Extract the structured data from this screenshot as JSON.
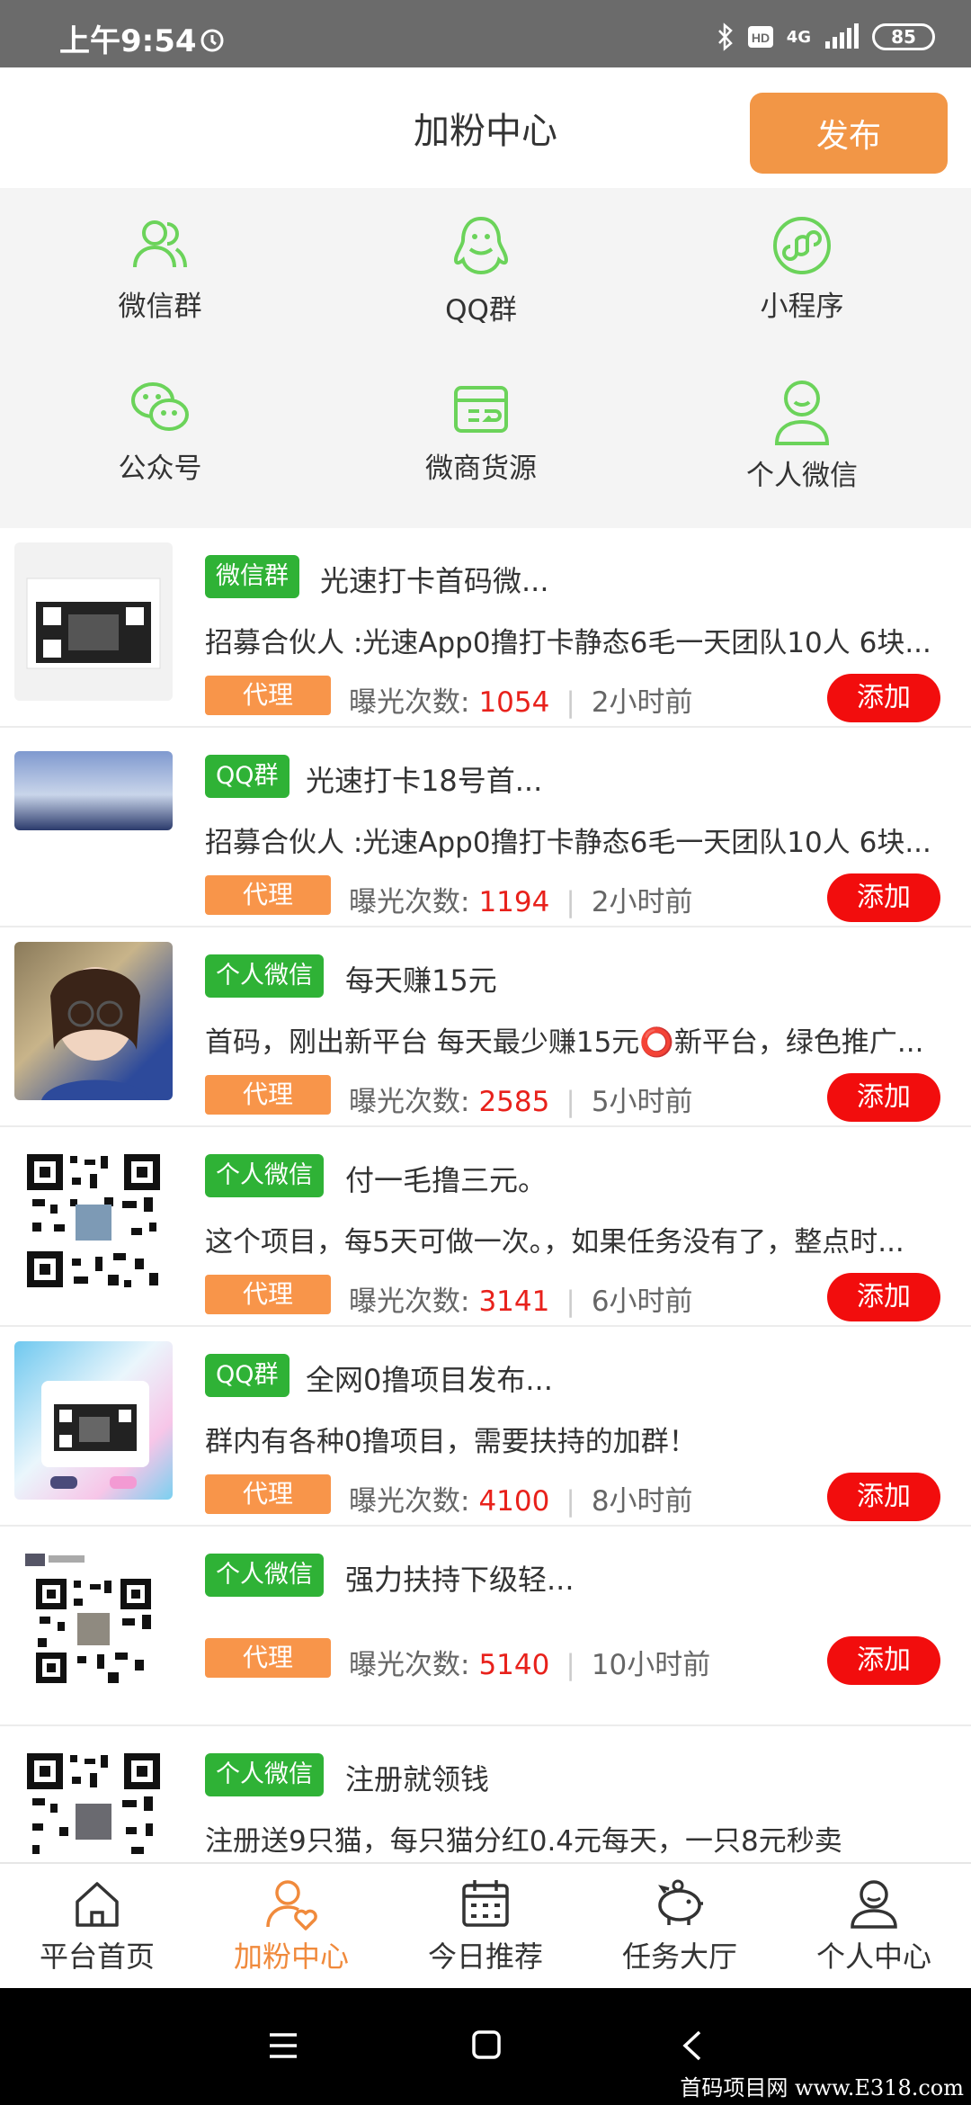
{
  "status_bar": {
    "time": "上午9:54",
    "network": "4G",
    "battery": "85"
  },
  "header": {
    "title": "加粉中心",
    "publish_label": "发布"
  },
  "categories": [
    {
      "label": "微信群",
      "icon": "users-icon"
    },
    {
      "label": "QQ群",
      "icon": "qq-penguin-icon"
    },
    {
      "label": "小程序",
      "icon": "mini-program-icon"
    },
    {
      "label": "公众号",
      "icon": "wechat-icon"
    },
    {
      "label": "微商货源",
      "icon": "supply-box-icon"
    },
    {
      "label": "个人微信",
      "icon": "person-icon"
    }
  ],
  "list_labels": {
    "exposure": "曝光次数:",
    "agent": "代理",
    "add": "添加"
  },
  "items": [
    {
      "tag": "微信群",
      "title": "光速打卡首码微...",
      "desc": "招募合伙人 :光速App0撸打卡静态6毛一天团队10人 6块...",
      "count": "1054",
      "time": "2小时前",
      "thumb": "qr-screenshot"
    },
    {
      "tag": "QQ群",
      "title": "光速打卡18号首...",
      "desc": "招募合伙人 :光速App0撸打卡静态6毛一天团队10人 6块...",
      "count": "1194",
      "time": "2小时前",
      "thumb": "sky-photo"
    },
    {
      "tag": "个人微信",
      "title": "每天赚15元",
      "desc": "首码，刚出新平台 每天最少赚15元⭕新平台，绿色推广...",
      "count": "2585",
      "time": "5小时前",
      "thumb": "portrait-photo"
    },
    {
      "tag": "个人微信",
      "title": "付一毛撸三元。",
      "desc": "这个项目，每5天可做一次。，如果任务没有了，整点时...",
      "count": "3141",
      "time": "6小时前",
      "thumb": "qr-code"
    },
    {
      "tag": "QQ群",
      "title": "全网0撸项目发布...",
      "desc": "群内有各种0撸项目，需要扶持的加群！",
      "count": "4100",
      "time": "8小时前",
      "thumb": "qr-colorful"
    },
    {
      "tag": "个人微信",
      "title": "强力扶持下级轻...",
      "desc": "",
      "count": "5140",
      "time": "10小时前",
      "thumb": "qr-code"
    },
    {
      "tag": "个人微信",
      "title": "注册就领钱",
      "desc": "注册送9只猫，每只猫分红0.4元每天，一只8元秒卖",
      "count": "",
      "time": "",
      "thumb": "qr-code"
    }
  ],
  "tabbar": [
    {
      "label": "平台首页",
      "icon": "home-icon"
    },
    {
      "label": "加粉中心",
      "icon": "add-fans-icon"
    },
    {
      "label": "今日推荐",
      "icon": "calendar-icon"
    },
    {
      "label": "任务大厅",
      "icon": "piggy-bank-icon"
    },
    {
      "label": "个人中心",
      "icon": "profile-icon"
    }
  ],
  "watermark": "首码项目网 www.E318.com",
  "colors": {
    "accent_orange": "#f29646",
    "tag_green": "#2fb236",
    "add_red": "#f20d0d",
    "count_red": "#e8211b",
    "icon_green": "#6bd35a"
  }
}
